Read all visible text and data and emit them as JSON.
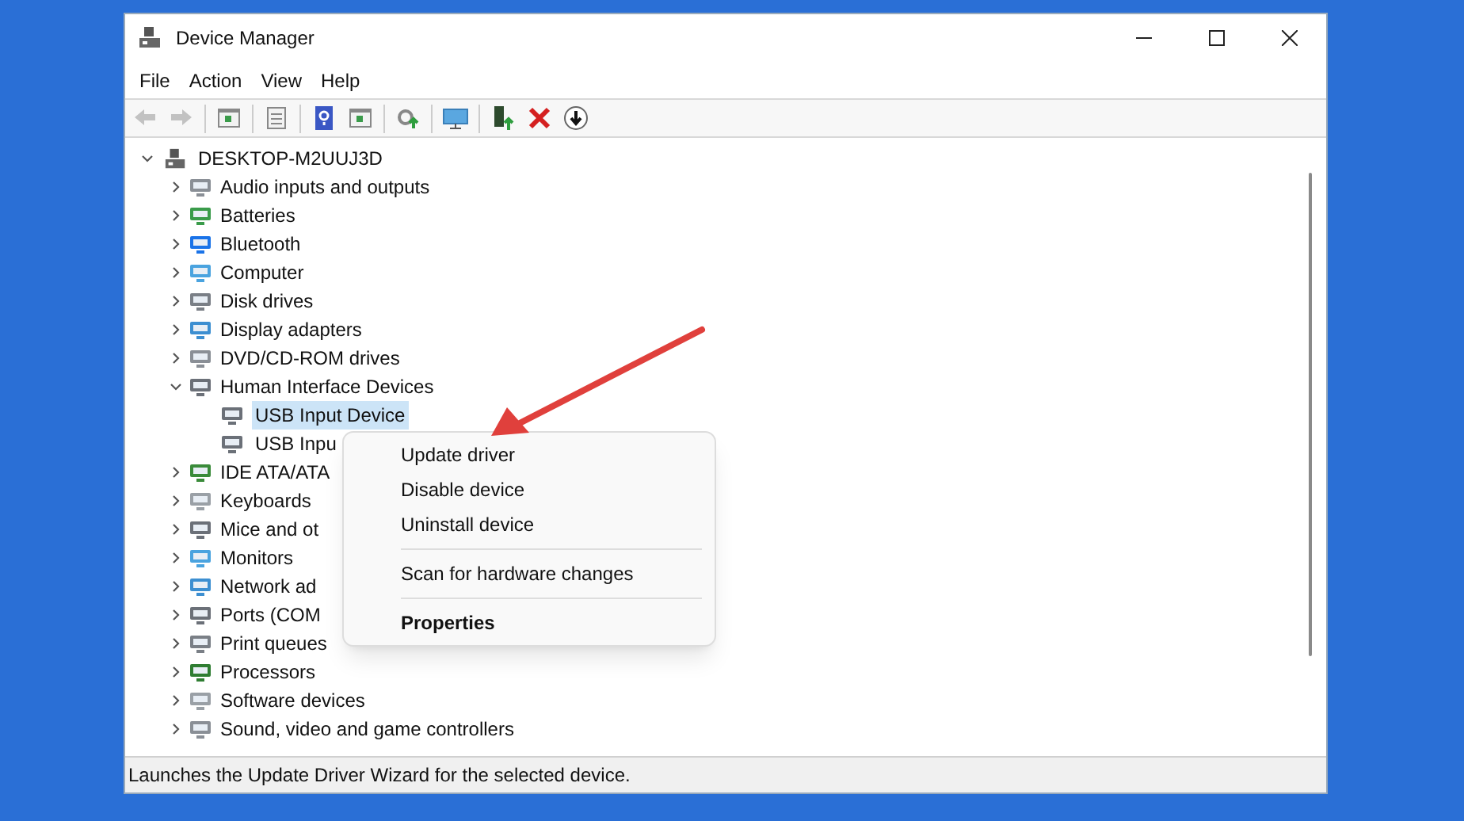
{
  "window": {
    "title": "Device Manager"
  },
  "menu_bar": [
    "File",
    "Action",
    "View",
    "Help"
  ],
  "toolbar": [
    {
      "kind": "back",
      "disabled": true
    },
    {
      "kind": "forward",
      "disabled": true
    },
    {
      "kind": "pane",
      "disabled": false
    },
    {
      "kind": "properties",
      "disabled": false
    },
    {
      "kind": "help",
      "disabled": false
    },
    {
      "kind": "pane",
      "disabled": false
    },
    {
      "kind": "update",
      "disabled": false
    },
    {
      "kind": "scan",
      "disabled": false
    },
    {
      "kind": "enable",
      "disabled": false
    },
    {
      "kind": "uninstall",
      "disabled": false
    },
    {
      "kind": "disable",
      "disabled": false
    }
  ],
  "tree": {
    "label": "DESKTOP-M2UUJ3D",
    "expanded": true,
    "children": [
      {
        "label": "Audio inputs and outputs",
        "expanded": false
      },
      {
        "label": "Batteries",
        "expanded": false
      },
      {
        "label": "Bluetooth",
        "expanded": false
      },
      {
        "label": "Computer",
        "expanded": false
      },
      {
        "label": "Disk drives",
        "expanded": false
      },
      {
        "label": "Display adapters",
        "expanded": false
      },
      {
        "label": "DVD/CD-ROM drives",
        "expanded": false
      },
      {
        "label": "Human Interface Devices",
        "expanded": true,
        "children": [
          {
            "label": "USB Input Device",
            "selected": true
          },
          {
            "label": "USB Inpu",
            "selected": false
          }
        ]
      },
      {
        "label": "IDE ATA/ATA",
        "expanded": false
      },
      {
        "label": "Keyboards",
        "expanded": false
      },
      {
        "label": "Mice and ot",
        "expanded": false
      },
      {
        "label": "Monitors",
        "expanded": false
      },
      {
        "label": "Network ad",
        "expanded": false
      },
      {
        "label": "Ports (COM",
        "expanded": false
      },
      {
        "label": "Print queues",
        "expanded": false
      },
      {
        "label": "Processors",
        "expanded": false
      },
      {
        "label": "Software devices",
        "expanded": false
      },
      {
        "label": "Sound, video and game controllers",
        "expanded": false
      }
    ]
  },
  "context_menu": [
    {
      "label": "Update driver",
      "bold": false,
      "separator_before": false
    },
    {
      "label": "Disable device",
      "bold": false,
      "separator_before": false
    },
    {
      "label": "Uninstall device",
      "bold": false,
      "separator_before": false
    },
    {
      "label": "Scan for hardware changes",
      "bold": false,
      "separator_before": true
    },
    {
      "label": "Properties",
      "bold": true,
      "separator_before": true
    }
  ],
  "status_bar": "Launches the Update Driver Wizard for the selected device."
}
